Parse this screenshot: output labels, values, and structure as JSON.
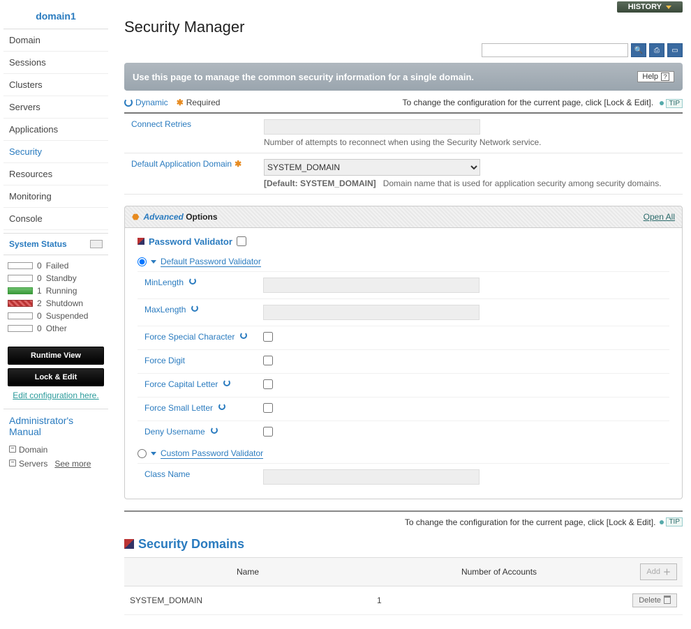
{
  "sidebar": {
    "title": "domain1",
    "menu": [
      "Domain",
      "Sessions",
      "Clusters",
      "Servers",
      "Applications",
      "Security",
      "Resources",
      "Monitoring",
      "Console"
    ],
    "active_index": 5,
    "system_status_heading": "System Status",
    "statuses": [
      {
        "count": 0,
        "label": "Failed",
        "kind": "empty"
      },
      {
        "count": 0,
        "label": "Standby",
        "kind": "empty"
      },
      {
        "count": 1,
        "label": "Running",
        "kind": "green"
      },
      {
        "count": 2,
        "label": "Shutdown",
        "kind": "red"
      },
      {
        "count": 0,
        "label": "Suspended",
        "kind": "empty"
      },
      {
        "count": 0,
        "label": "Other",
        "kind": "empty"
      }
    ],
    "runtime_btn": "Runtime View",
    "lockedit_btn": "Lock & Edit",
    "editconf_link": "Edit configuration here.",
    "manual_heading": "Administrator's Manual",
    "manual_items": [
      "Domain",
      "Servers"
    ],
    "see_more": "See more"
  },
  "top": {
    "history_label": "HISTORY",
    "title": "Security Manager"
  },
  "banner": {
    "text": "Use this page to manage the common security information for a single domain.",
    "help": "Help"
  },
  "legend": {
    "dynamic": "Dynamic",
    "required": "Required",
    "hint": "To change the configuration for the current page, click [Lock & Edit].",
    "tip": "TIP"
  },
  "form": {
    "connect_retries": {
      "label": "Connect Retries",
      "desc": "Number of attempts to reconnect when using the Security Network service."
    },
    "default_app_domain": {
      "label": "Default Application Domain",
      "selected": "SYSTEM_DOMAIN",
      "default_prefix": "[Default: SYSTEM_DOMAIN]",
      "desc": "Domain name that is used for application security among security domains."
    }
  },
  "advanced": {
    "word_adv": "Advanced",
    "word_opt": "Options",
    "open_all": "Open All",
    "password_validator": "Password Validator",
    "default_pwd_validator": "Default Password Validator",
    "custom_pwd_validator": "Custom Password Validator",
    "rows": {
      "minlength": "MinLength",
      "maxlength": "MaxLength",
      "force_special": "Force Special Character",
      "force_digit": "Force Digit",
      "force_capital": "Force Capital Letter",
      "force_small": "Force Small Letter",
      "deny_username": "Deny Username",
      "class_name": "Class Name"
    }
  },
  "hint2": "To change the configuration for the current page, click [Lock & Edit].",
  "sec_domains": {
    "heading": "Security Domains",
    "col_name": "Name",
    "col_accounts": "Number of Accounts",
    "add_btn": "Add",
    "delete_btn": "Delete",
    "rows": [
      {
        "name": "SYSTEM_DOMAIN",
        "accounts": 1
      }
    ]
  }
}
